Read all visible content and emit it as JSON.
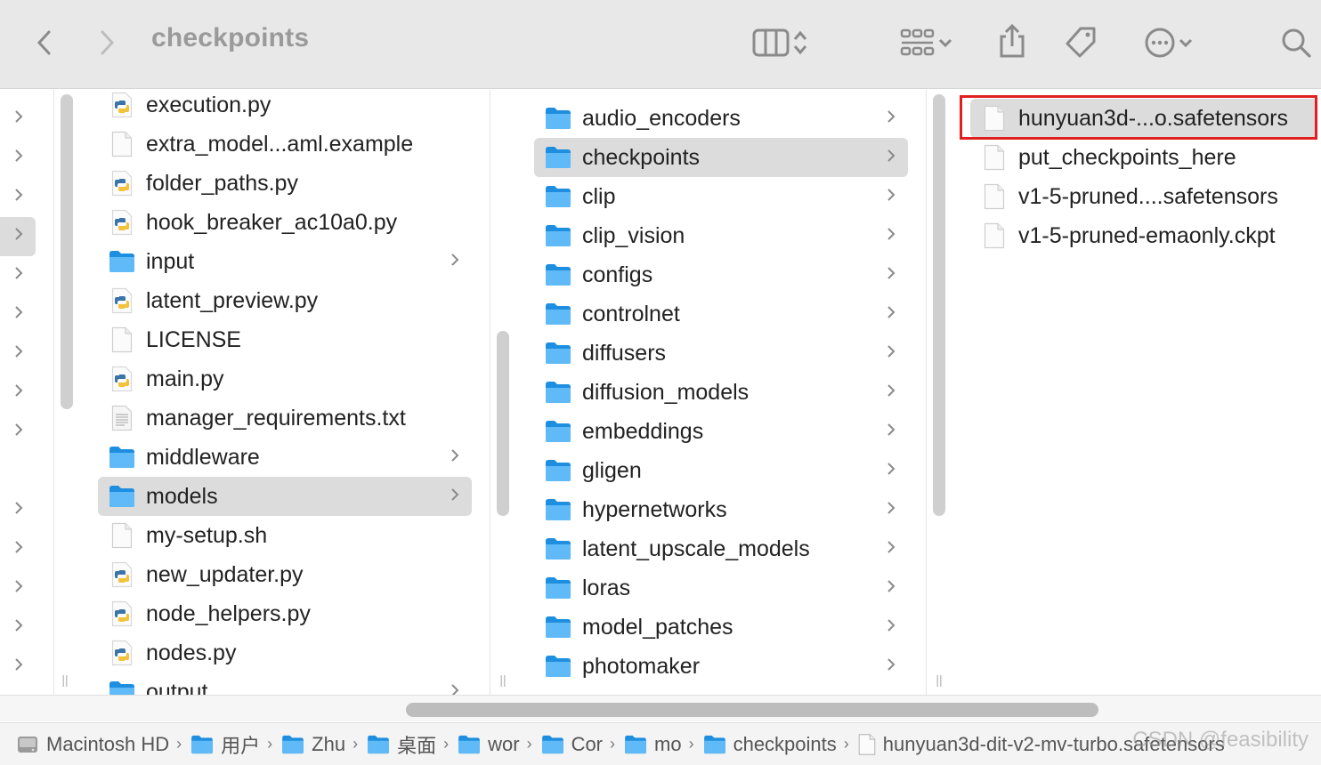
{
  "toolbar": {
    "title": "checkpoints",
    "back_icon": "chevron-left",
    "forward_icon": "chevron-right"
  },
  "col1": [
    {
      "label": "execution.py",
      "type": "py"
    },
    {
      "label": "extra_model...aml.example",
      "type": "file"
    },
    {
      "label": "folder_paths.py",
      "type": "py"
    },
    {
      "label": "hook_breaker_ac10a0.py",
      "type": "py"
    },
    {
      "label": "input",
      "type": "folder"
    },
    {
      "label": "latent_preview.py",
      "type": "py"
    },
    {
      "label": "LICENSE",
      "type": "file"
    },
    {
      "label": "main.py",
      "type": "py"
    },
    {
      "label": "manager_requirements.txt",
      "type": "txt"
    },
    {
      "label": "middleware",
      "type": "folder"
    },
    {
      "label": "models",
      "type": "folder",
      "selected": true
    },
    {
      "label": "my-setup.sh",
      "type": "file"
    },
    {
      "label": "new_updater.py",
      "type": "py"
    },
    {
      "label": "node_helpers.py",
      "type": "py"
    },
    {
      "label": "nodes.py",
      "type": "py"
    },
    {
      "label": "output",
      "type": "folder"
    }
  ],
  "col2": [
    {
      "label": "audio_encoders"
    },
    {
      "label": "checkpoints",
      "selected": true
    },
    {
      "label": "clip"
    },
    {
      "label": "clip_vision"
    },
    {
      "label": "configs"
    },
    {
      "label": "controlnet"
    },
    {
      "label": "diffusers"
    },
    {
      "label": "diffusion_models"
    },
    {
      "label": "embeddings"
    },
    {
      "label": "gligen"
    },
    {
      "label": "hypernetworks"
    },
    {
      "label": "latent_upscale_models"
    },
    {
      "label": "loras"
    },
    {
      "label": "model_patches"
    },
    {
      "label": "photomaker"
    }
  ],
  "col3": [
    {
      "label": "hunyuan3d-...o.safetensors",
      "selected": true
    },
    {
      "label": "put_checkpoints_here"
    },
    {
      "label": "v1-5-pruned....safetensors"
    },
    {
      "label": "v1-5-pruned-emaonly.ckpt"
    }
  ],
  "pathbar": [
    {
      "label": "Macintosh HD",
      "icon": "disk"
    },
    {
      "label": "用户",
      "icon": "folder-home"
    },
    {
      "label": "Zhu",
      "icon": "folder-home"
    },
    {
      "label": "桌面",
      "icon": "folder-desktop"
    },
    {
      "label": "wor",
      "icon": "folder"
    },
    {
      "label": "Cor",
      "icon": "folder"
    },
    {
      "label": "mo",
      "icon": "folder"
    },
    {
      "label": "checkpoints",
      "icon": "folder"
    },
    {
      "label": "hunyuan3d-dit-v2-mv-turbo.safetensors",
      "icon": "file"
    }
  ],
  "watermark": "CSDN @feasibility",
  "colors": {
    "folder": "#3aa6f0",
    "selection": "#dcdcdc",
    "highlight": "#e02020"
  }
}
